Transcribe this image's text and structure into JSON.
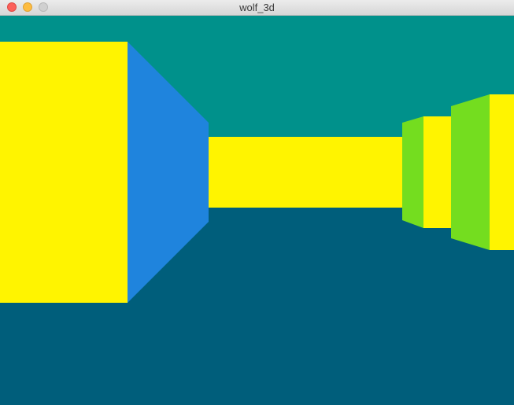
{
  "window": {
    "title": "wolf_3d"
  },
  "scene": {
    "ceiling_color": "#00918b",
    "floor_color": "#005e7b",
    "wall_colors": {
      "north_face": "#fff400",
      "west_face": "#1f84dd",
      "east_face": "#74dd1f"
    }
  }
}
